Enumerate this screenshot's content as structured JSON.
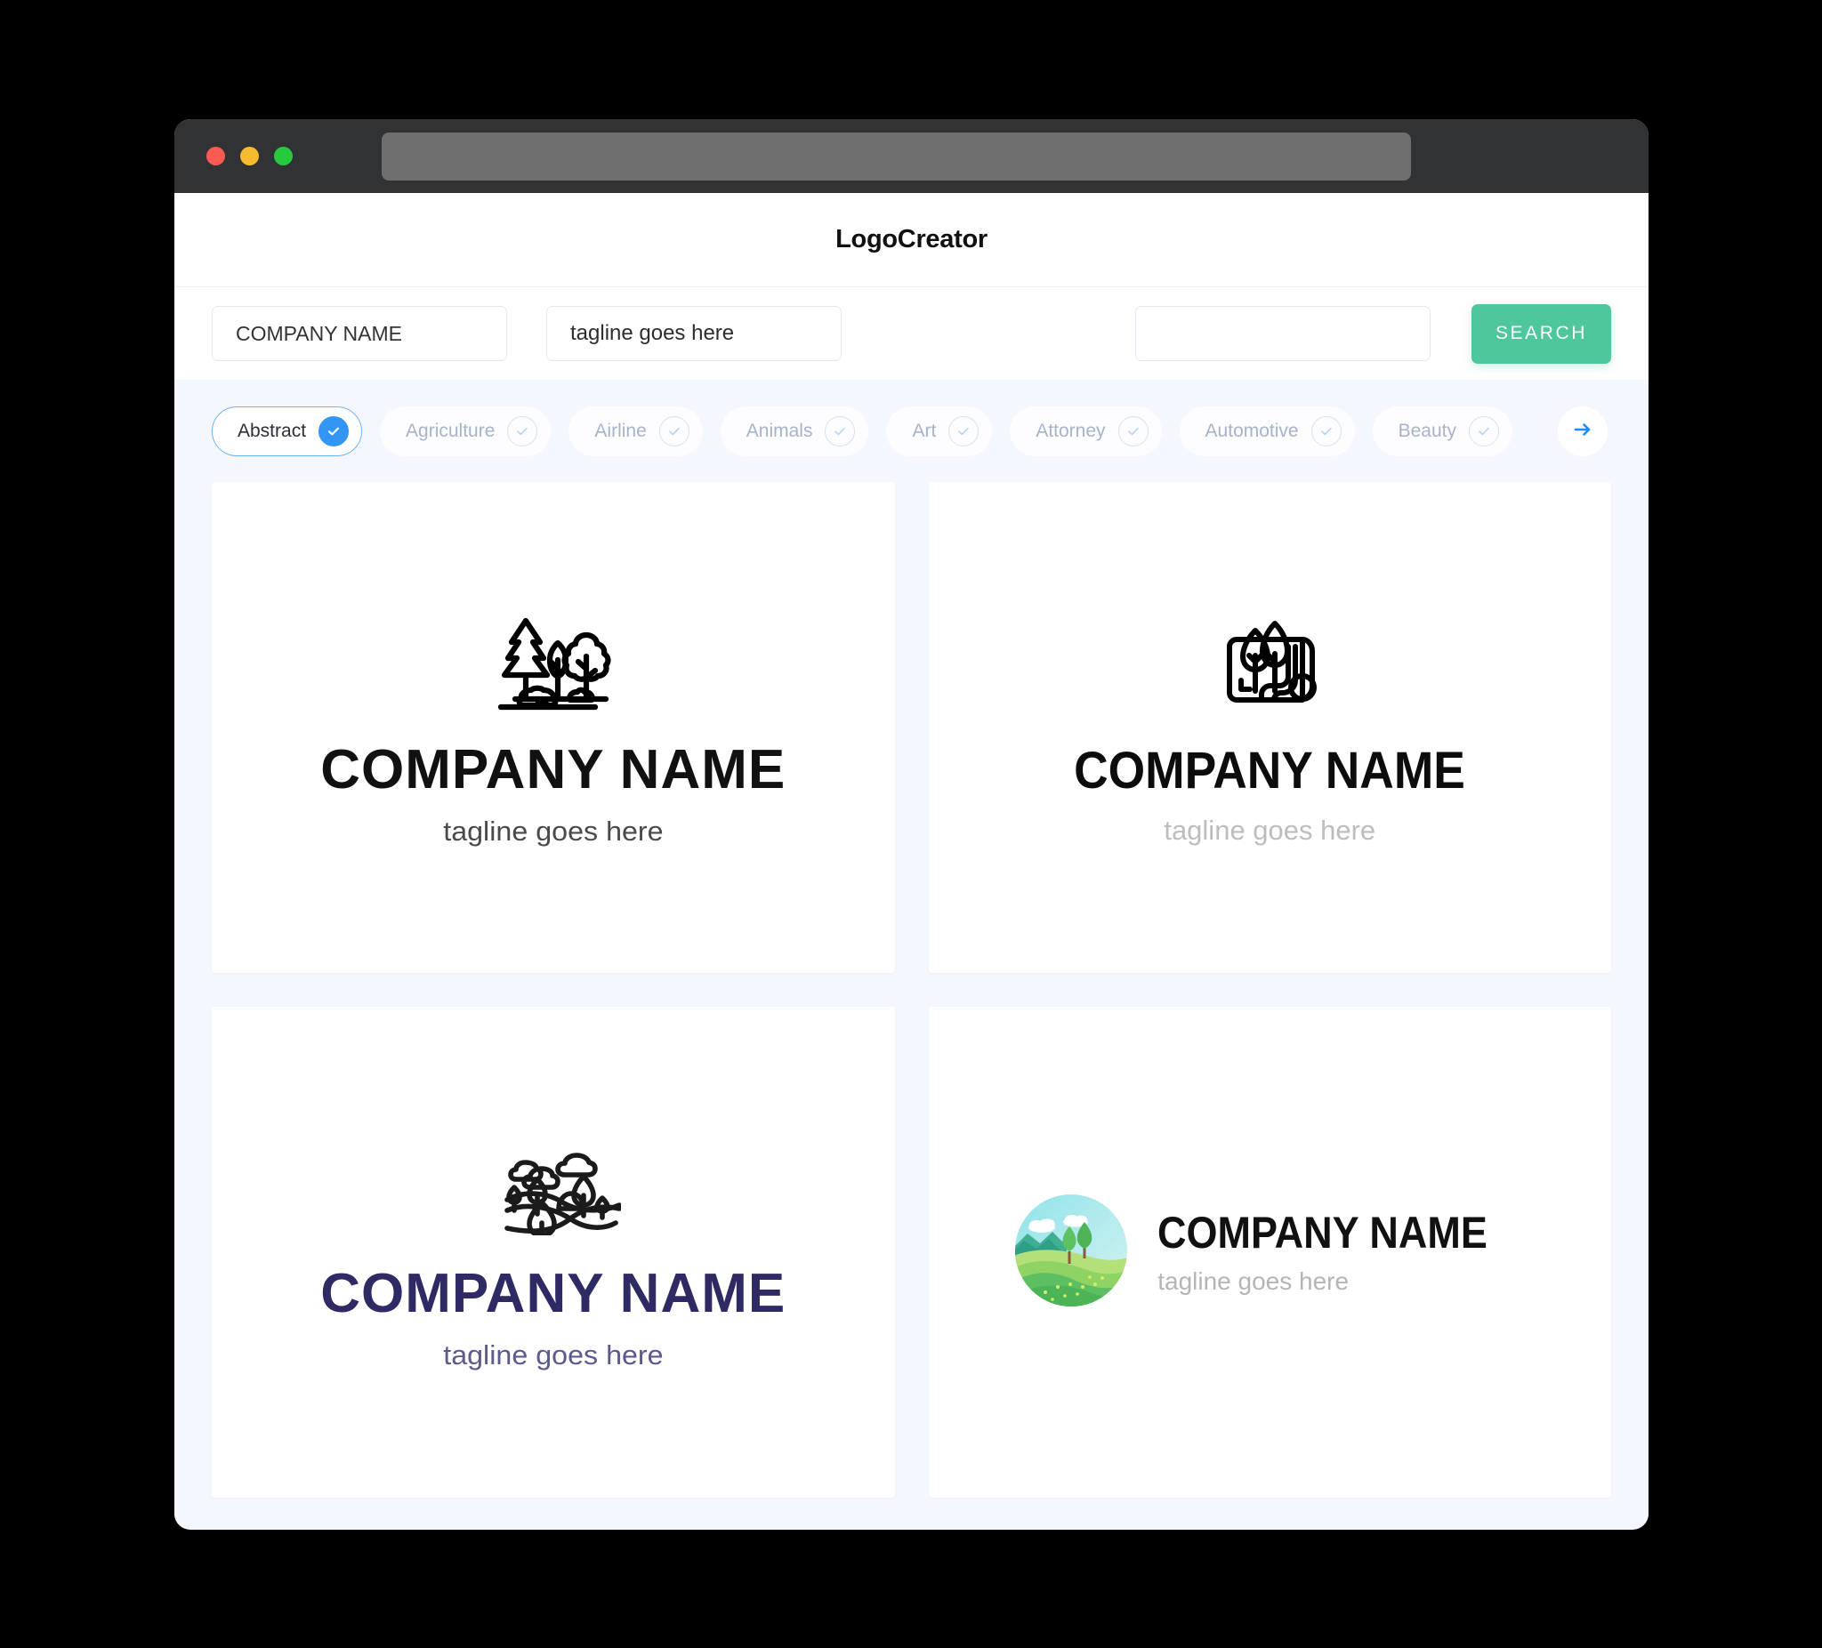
{
  "window": {
    "traffic_lights": [
      "close",
      "minimize",
      "maximize"
    ],
    "url_value": ""
  },
  "header": {
    "title": "LogoCreator"
  },
  "search": {
    "company_value": "COMPANY NAME",
    "company_placeholder": "COMPANY NAME",
    "tagline_value": "tagline goes here",
    "tagline_placeholder": "tagline goes here",
    "keyword_value": "",
    "keyword_placeholder": "",
    "button_label": "SEARCH",
    "button_color": "#4ec79d"
  },
  "categories": {
    "next_icon": "arrow-right-icon",
    "items": [
      {
        "label": "Abstract",
        "selected": true
      },
      {
        "label": "Agriculture",
        "selected": false
      },
      {
        "label": "Airline",
        "selected": false
      },
      {
        "label": "Animals",
        "selected": false
      },
      {
        "label": "Art",
        "selected": false
      },
      {
        "label": "Attorney",
        "selected": false
      },
      {
        "label": "Automotive",
        "selected": false
      },
      {
        "label": "Beauty",
        "selected": false
      }
    ],
    "selected_accent": "#3296f5"
  },
  "results": [
    {
      "icon": "forest-trees-icon",
      "company_name": "COMPANY NAME",
      "tagline": "tagline goes here",
      "name_color": "#111111",
      "tagline_color": "#4a4a4a",
      "layout": "stacked"
    },
    {
      "icon": "landscape-plan-scroll-icon",
      "company_name": "COMPANY NAME",
      "tagline": "tagline goes here",
      "name_color": "#0c0c0c",
      "tagline_color": "#bdbdbd",
      "layout": "stacked"
    },
    {
      "icon": "rolling-hills-clouds-icon",
      "company_name": "COMPANY NAME",
      "tagline": "tagline goes here",
      "name_color": "#2e2a63",
      "tagline_color": "#5b5a8c",
      "layout": "stacked"
    },
    {
      "icon": "circular-landscape-badge-icon",
      "company_name": "COMPANY NAME",
      "tagline": "tagline goes here",
      "name_color": "#111111",
      "tagline_color": "#b5b5b5",
      "layout": "inline"
    }
  ]
}
